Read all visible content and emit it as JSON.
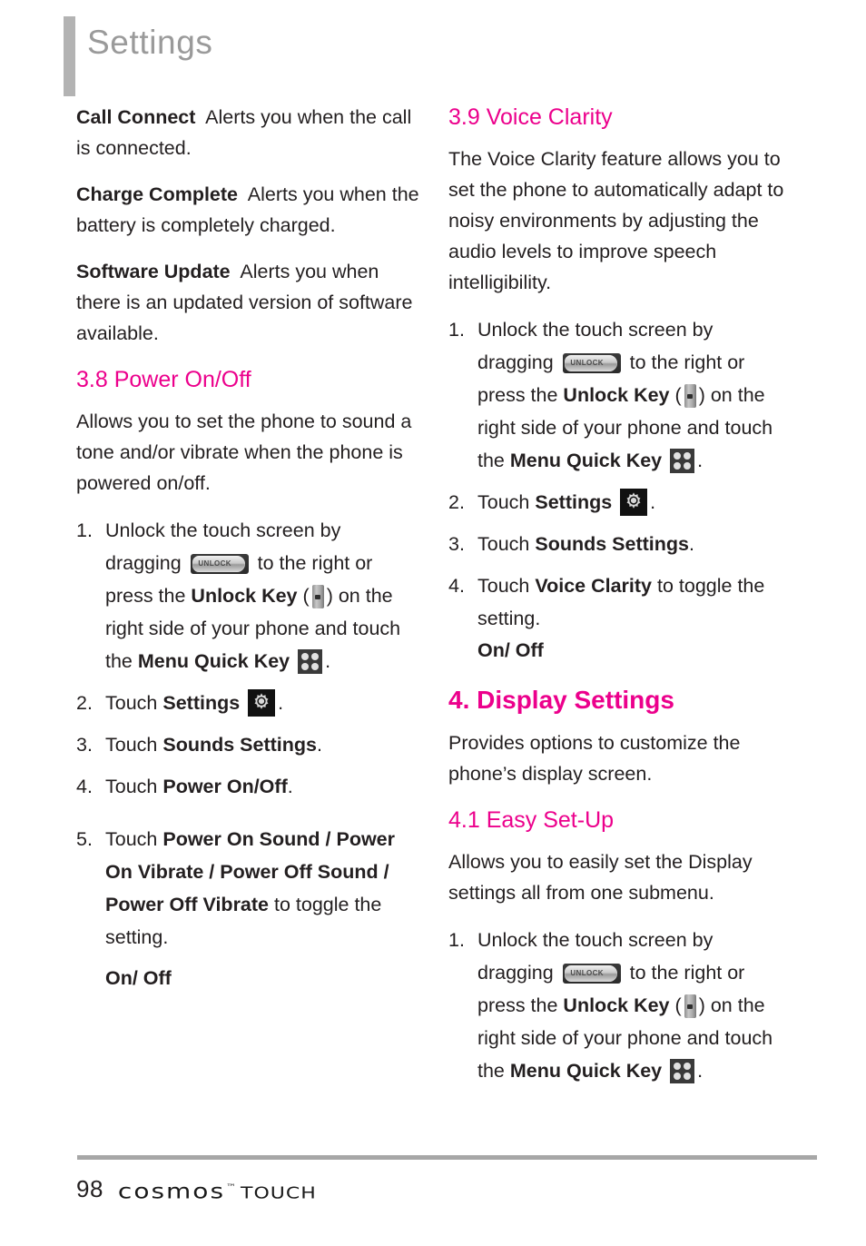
{
  "header": {
    "title": "Settings"
  },
  "left_column": {
    "definitions": [
      {
        "term": "Call Connect",
        "definition": "Alerts you when the call is connected."
      },
      {
        "term": "Charge Complete",
        "definition": "Alerts you when the battery is completely charged."
      },
      {
        "term": "Software Update",
        "definition": "Alerts you when there is an updated version of software available."
      }
    ],
    "section_3_8": {
      "heading": "3.8 Power On/Off",
      "intro": "Allows you to set the phone to sound a tone and/or vibrate when the phone is powered on/off.",
      "steps": [
        {
          "num": "1.",
          "part1": "Unlock the touch screen by dragging",
          "icon1": "unlock-slider-icon",
          "part2": "to the right or press the",
          "bold1": "Unlock Key",
          "paren_open": "(",
          "icon2": "unlock-key-icon",
          "paren_close": ")",
          "part3": "on the right side of your phone and touch the",
          "bold2": "Menu Quick Key",
          "icon3": "menu-quick-key-icon",
          "part4": "."
        },
        {
          "num": "2.",
          "part1": "Touch",
          "bold1": "Settings",
          "icon1": "settings-gear-icon",
          "part2": "."
        },
        {
          "num": "3.",
          "part1": "Touch",
          "bold1": "Sounds Settings",
          "part2": "."
        },
        {
          "num": "4.",
          "part1": "Touch",
          "bold1": "Power On/Off",
          "part2": "."
        },
        {
          "num": "5.",
          "part1": "Touch",
          "bold1": "Power On Sound / Power On Vibrate / Power Off Sound / Power Off Vibrate",
          "part2": "to toggle the setting."
        }
      ],
      "toggle_values": "On/ Off"
    }
  },
  "right_column": {
    "section_3_9": {
      "heading": "3.9 Voice Clarity",
      "intro": "The Voice Clarity feature allows you to set the phone to automatically adapt to noisy environments by adjusting the audio levels to improve speech intelligibility.",
      "steps": [
        {
          "num": "1.",
          "part1": "Unlock the touch screen by dragging",
          "icon1": "unlock-slider-icon",
          "part2": "to the right or press the",
          "bold1": "Unlock Key",
          "paren_open": "(",
          "icon2": "unlock-key-icon",
          "paren_close": ")",
          "part3": "on the right side of your phone and touch the",
          "bold2": "Menu Quick Key",
          "icon3": "menu-quick-key-icon",
          "part4": "."
        },
        {
          "num": "2.",
          "part1": "Touch",
          "bold1": "Settings",
          "icon1": "settings-gear-icon",
          "part2": "."
        },
        {
          "num": "3.",
          "part1": "Touch",
          "bold1": "Sounds Settings",
          "part2": "."
        },
        {
          "num": "4.",
          "part1": "Touch",
          "bold1": "Voice Clarity",
          "part2": "to toggle the setting.",
          "toggle_values": "On/ Off"
        }
      ]
    },
    "section_4": {
      "heading": "4. Display Settings",
      "intro": "Provides options to customize the phone’s display screen."
    },
    "section_4_1": {
      "heading": "4.1 Easy Set-Up",
      "intro": "Allows you to easily set the Display settings all from one submenu.",
      "steps": [
        {
          "num": "1.",
          "part1": "Unlock the touch screen by dragging",
          "icon1": "unlock-slider-icon",
          "part2": "to the right or press the",
          "bold1": "Unlock Key",
          "paren_open": "(",
          "icon2": "unlock-key-icon",
          "paren_close": ")",
          "part3": "on the right side of your phone and touch the",
          "bold2": "Menu Quick Key",
          "icon3": "menu-quick-key-icon",
          "part4": "."
        }
      ]
    }
  },
  "icons": {
    "unlock_slider_label": "UNLOCK"
  },
  "footer": {
    "page_number": "98",
    "brand": "cosmos",
    "trademark": "™",
    "brand_suffix": "TOUCH"
  },
  "colors": {
    "heading_magenta": "#ec008c",
    "header_gray": "#9a9a9a",
    "rule_gray": "#a7a7a7",
    "body_text": "#231f20"
  }
}
